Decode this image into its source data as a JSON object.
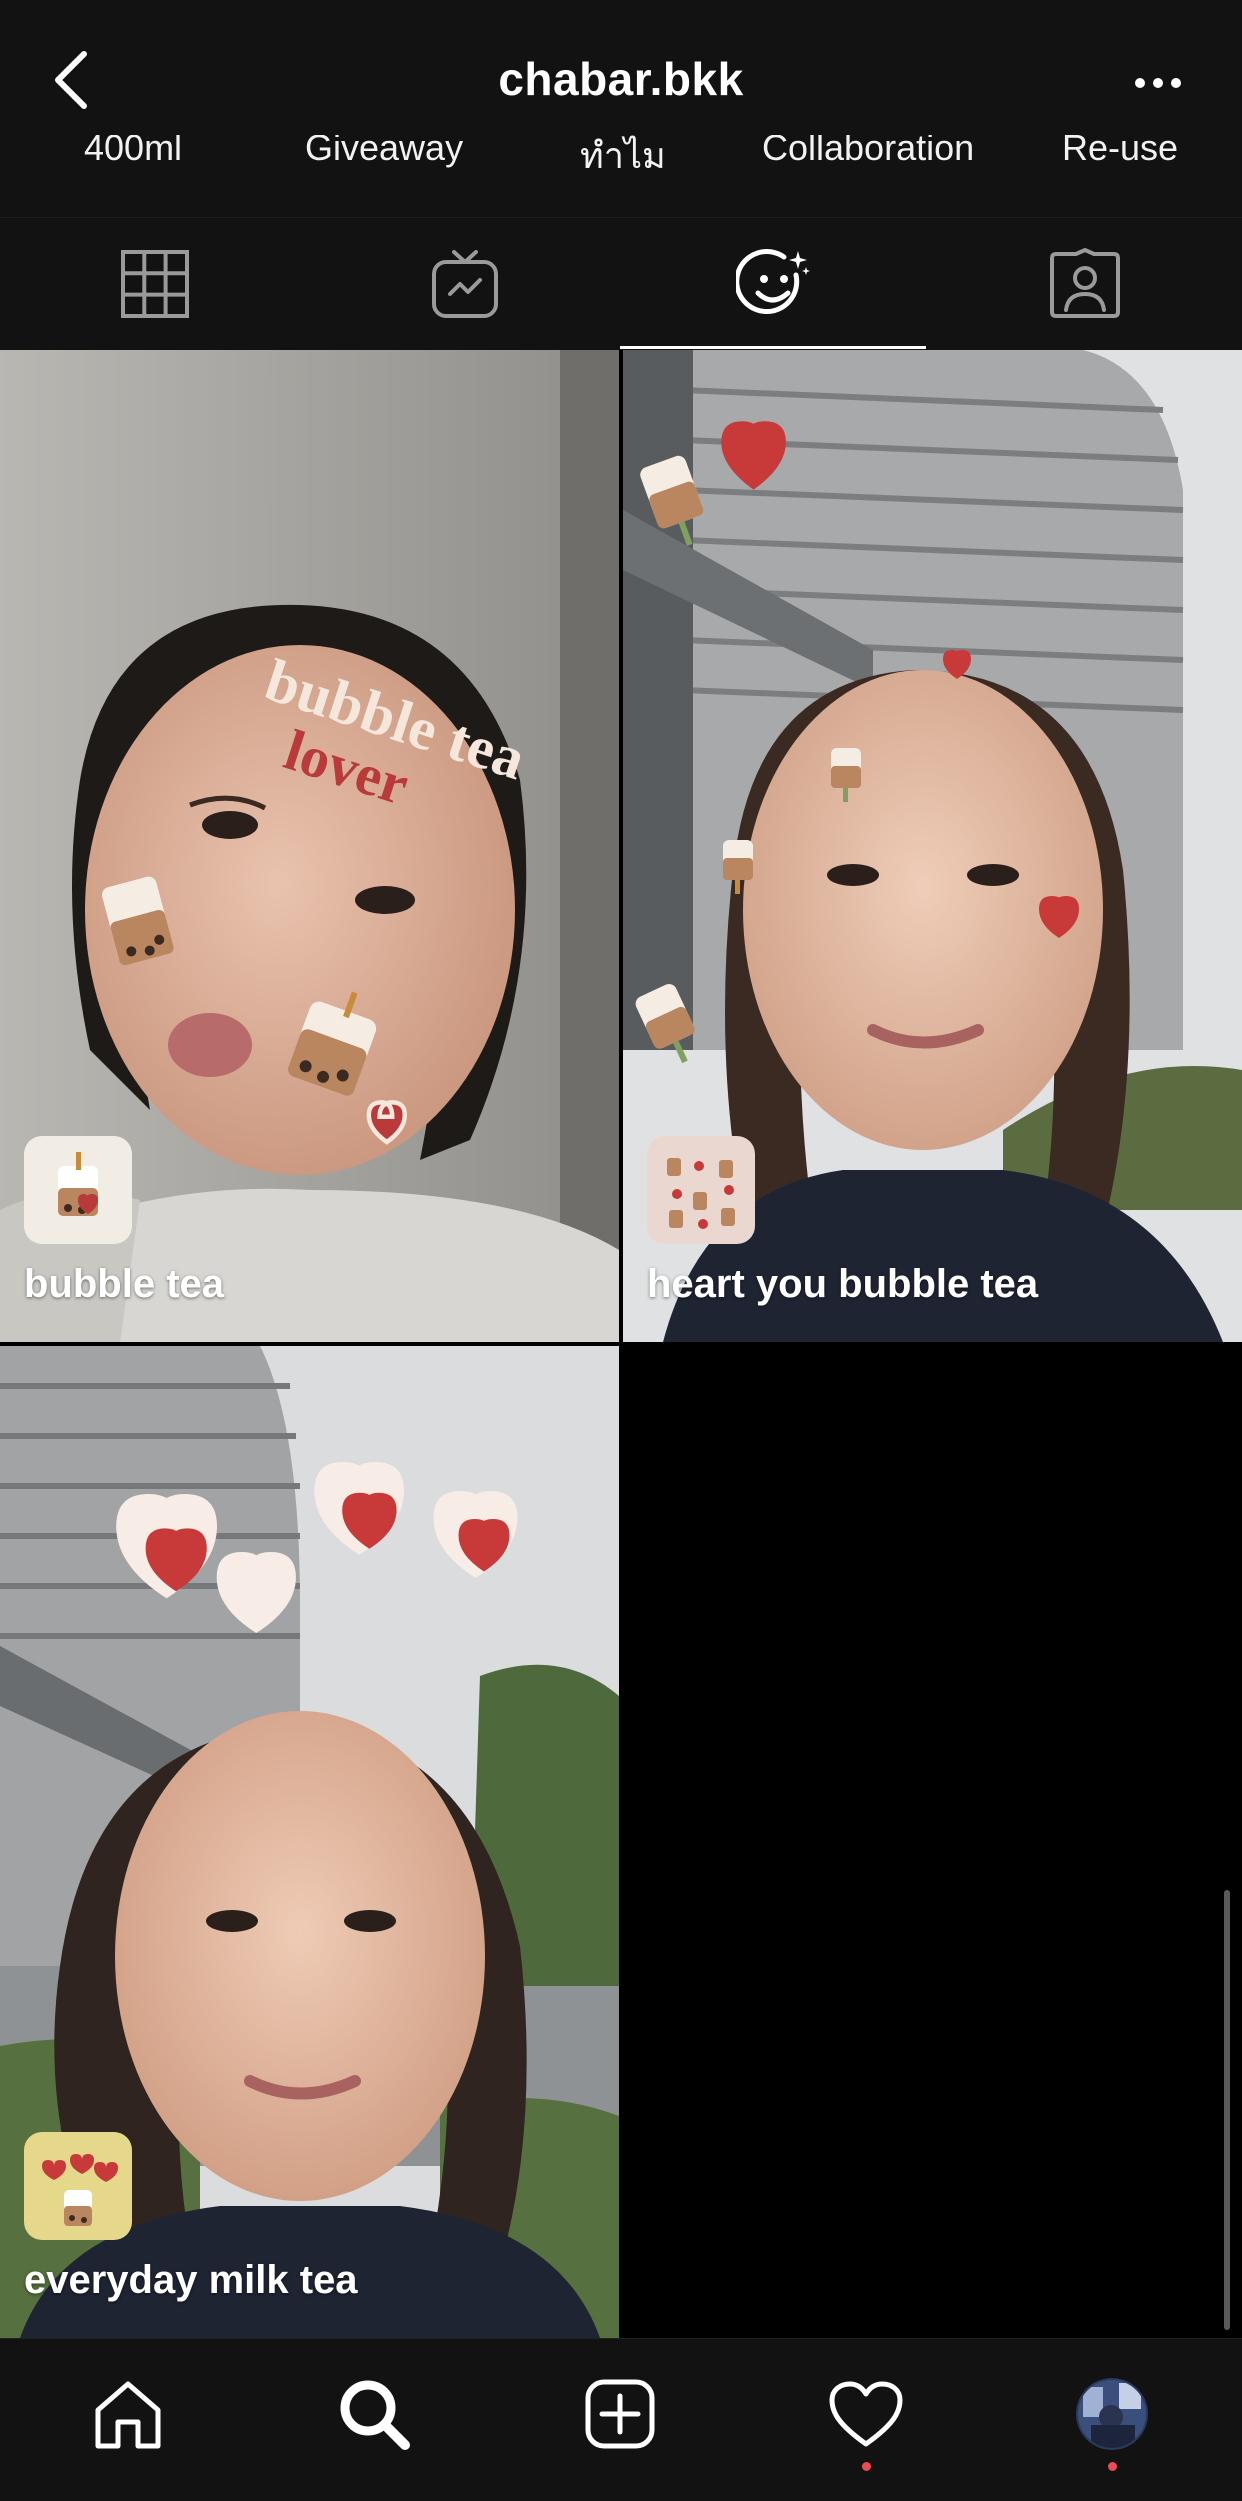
{
  "header": {
    "back_icon": "chevron-left-icon",
    "title": "chabar.bkk",
    "more_icon": "more-horizontal-icon"
  },
  "highlights": [
    "400ml",
    "Giveaway",
    "ทำไม",
    "Collaboration",
    "Re-use"
  ],
  "tabs": [
    {
      "icon": "grid-icon",
      "active": false
    },
    {
      "icon": "igtv-icon",
      "active": false
    },
    {
      "icon": "effects-face-icon",
      "active": true
    },
    {
      "icon": "tagged-person-icon",
      "active": false
    }
  ],
  "effects": [
    {
      "label": "bubble tea"
    },
    {
      "label": "heart you bubble tea"
    },
    {
      "label": "everyday milk tea"
    }
  ],
  "overlay_text": {
    "line1": "bubble tea",
    "line2": "lover"
  },
  "bottom_nav": {
    "items": [
      "home-icon",
      "search-icon",
      "new-post-icon",
      "activity-heart-icon",
      "profile-avatar"
    ]
  },
  "colors": {
    "background": "#000000",
    "bar": "#121212",
    "notification_dot": "#ed4956"
  }
}
